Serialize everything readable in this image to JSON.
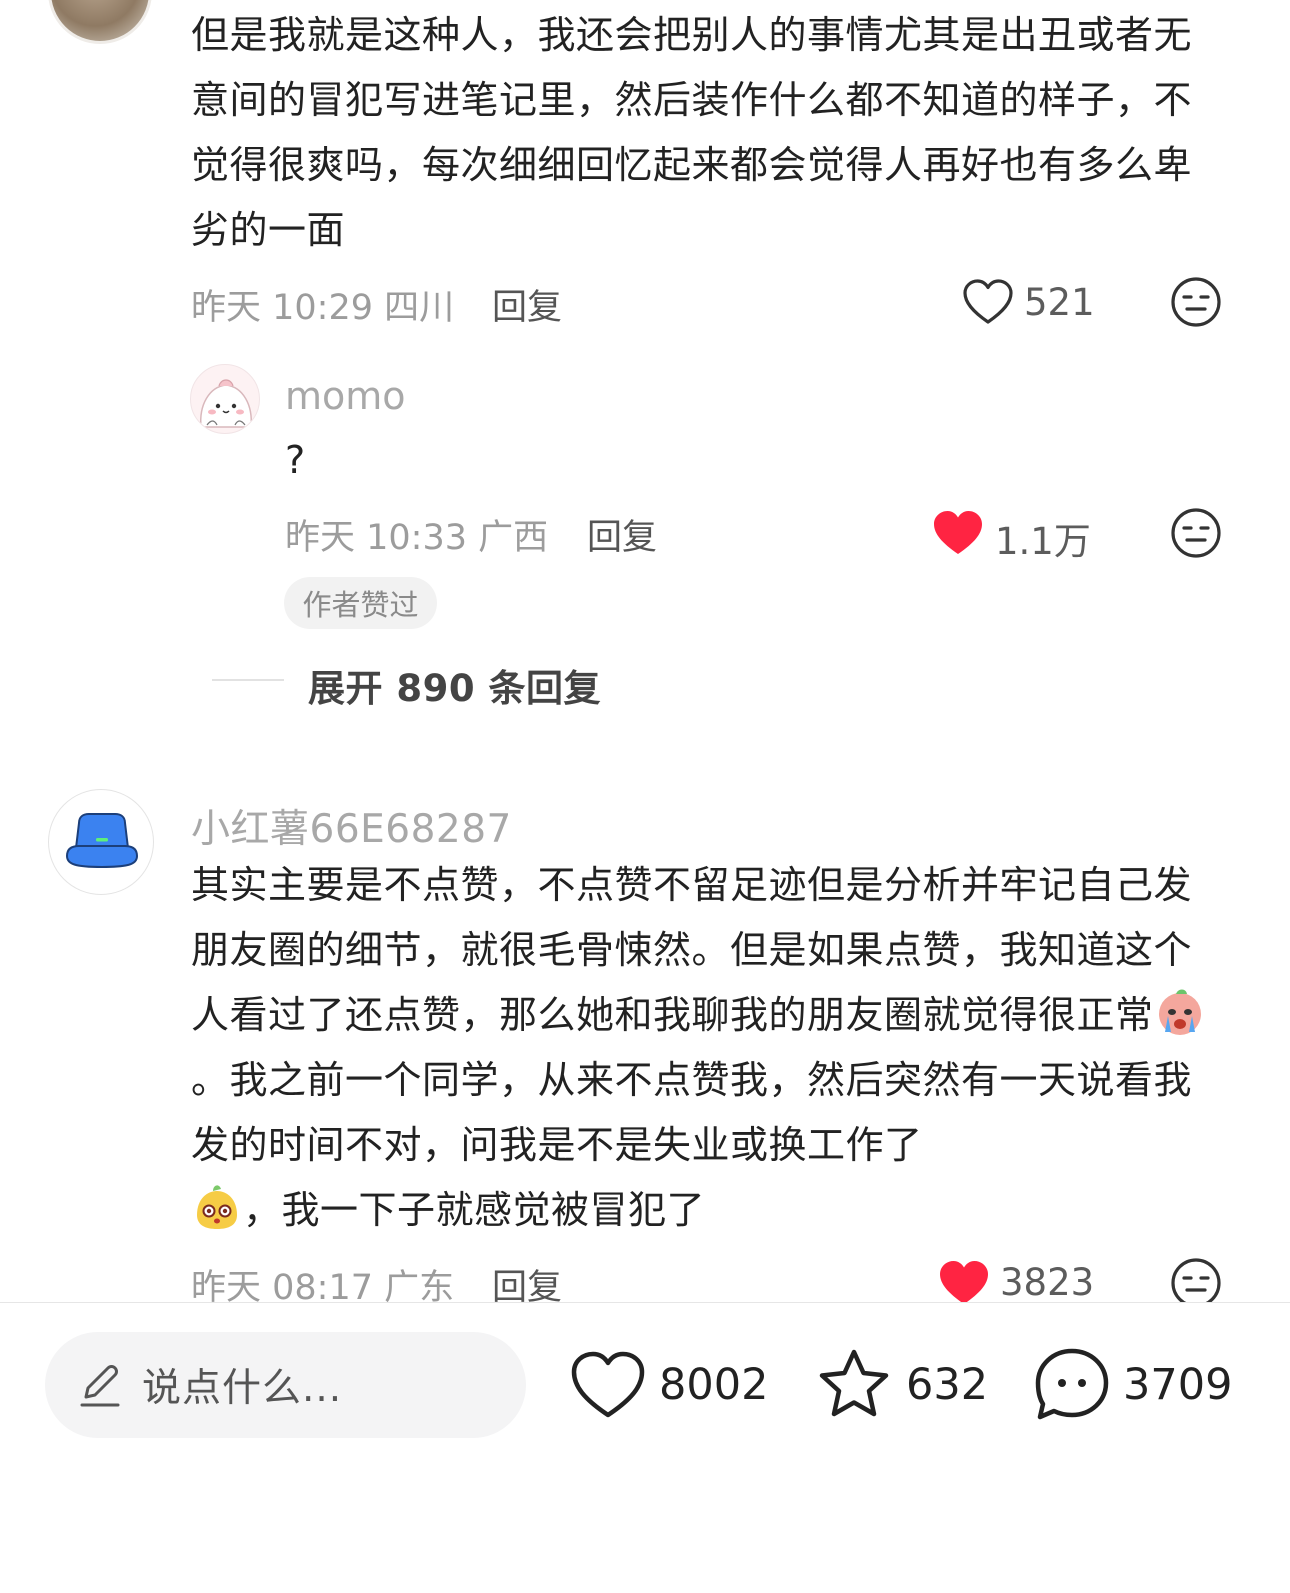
{
  "comments": [
    {
      "text": "但是我就是这种人，我还会把别人的事情尤其是出丑或者无意间的冒犯写进笔记里，然后装作什么都不知道的样子，不觉得很爽吗，每次细细回忆起来都会觉得人再好也有多么卑劣的一面",
      "time": "昨天 10:29",
      "location": "四川",
      "reply_label": "回复",
      "likes": "521",
      "liked": false,
      "sub_replies": [
        {
          "username": "momo",
          "text": "?",
          "time": "昨天 10:33",
          "location": "广西",
          "reply_label": "回复",
          "likes": "1.1万",
          "liked": true,
          "badge": "作者赞过"
        }
      ],
      "expand_label": "展开 890 条回复"
    },
    {
      "username": "小红薯66E68287",
      "text_part1": "其实主要是不点赞，不点赞不留足迹但是分析并牢记自己发朋友圈的细节，就很毛骨悚然。但是如果点赞，我知道这个人看过了还点赞，那么她和我聊我的朋友圈就觉得很正常",
      "text_part2": "。我之前一个同学，从来不点赞我，然后突然有一天说看我发的时间不对，问我是不是失业或换工作了",
      "text_part3": "，我一下子就感觉被冒犯了",
      "emojis": [
        "crying-face-emoji",
        "surprised-face-emoji"
      ],
      "time": "昨天 08:17",
      "location": "广东",
      "reply_label": "回复",
      "likes": "3823",
      "liked": true
    }
  ],
  "bottom_bar": {
    "input_placeholder": "说点什么...",
    "like_count": "8002",
    "collect_count": "632",
    "comment_count": "3709"
  },
  "colors": {
    "liked_heart": "#ff2442",
    "icon_stroke": "#333333",
    "meta_text": "#9c9c9c"
  }
}
